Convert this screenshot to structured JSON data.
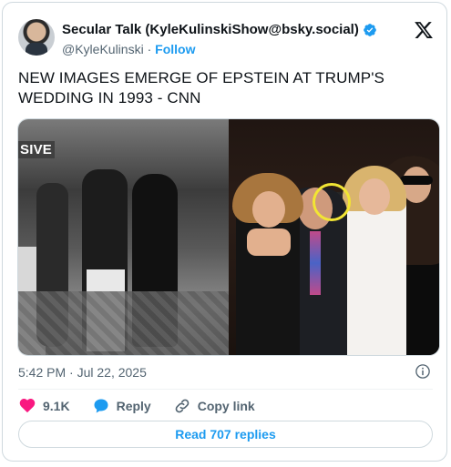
{
  "author": {
    "display_name": "Secular Talk (KyleKulinskiShow@bsky.social)",
    "handle": "@KyleKulinski",
    "separator": "·",
    "follow_label": "Follow",
    "verified_color": "#1d9bf0"
  },
  "tweet": {
    "text": "NEW IMAGES EMERGE OF EPSTEIN AT TRUMP'S WEDDING IN 1993 - CNN",
    "media_overlay_text": "SIVE",
    "timestamp": "5:42 PM · Jul 22, 2025"
  },
  "actions": {
    "like_count": "9.1K",
    "reply_label": "Reply",
    "copy_label": "Copy link"
  },
  "footer": {
    "read_replies_label": "Read 707 replies"
  },
  "colors": {
    "accent": "#1d9bf0",
    "like": "#f91880",
    "muted": "#536471",
    "sive_badge": "#d01919",
    "highlight_circle": "#f2e534"
  },
  "icons": {
    "platform": "x-logo-icon",
    "verified": "verified-badge-icon",
    "info": "info-icon",
    "like": "heart-icon",
    "reply": "speech-bubble-icon",
    "copy": "link-icon"
  }
}
